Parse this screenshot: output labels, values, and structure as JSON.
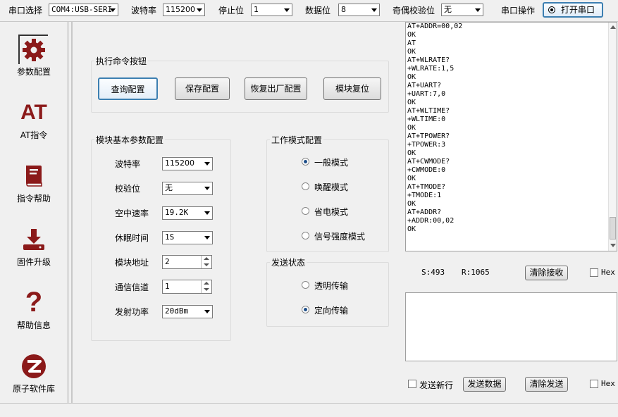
{
  "toolbar": {
    "port_label": "串口选择",
    "port_value": "COM4:USB-SERI",
    "baud_label": "波特率",
    "baud_value": "115200",
    "stop_label": "停止位",
    "stop_value": "1",
    "data_label": "数据位",
    "data_value": "8",
    "parity_label": "奇偶校验位",
    "parity_value": "无",
    "serial_op_label": "串口操作",
    "open_port_label": "打开串口"
  },
  "sidebar": {
    "items": [
      {
        "label": "参数配置",
        "icon": "gear-icon"
      },
      {
        "label": "AT指令",
        "icon": "at-icon"
      },
      {
        "label": "指令帮助",
        "icon": "book-icon"
      },
      {
        "label": "固件升级",
        "icon": "download-icon"
      },
      {
        "label": "帮助信息",
        "icon": "question-icon"
      },
      {
        "label": "原子软件库",
        "icon": "logo-icon"
      }
    ],
    "at_text": "AT",
    "help_text": "?"
  },
  "commands": {
    "title": "执行命令按钮",
    "query": "查询配置",
    "save": "保存配置",
    "restore": "恢复出厂配置",
    "reset": "模块复位"
  },
  "basic": {
    "title": "模块基本参数配置",
    "rows": [
      {
        "label": "波特率",
        "value": "115200"
      },
      {
        "label": "校验位",
        "value": "无"
      },
      {
        "label": "空中速率",
        "value": "19.2K"
      },
      {
        "label": "休眠时间",
        "value": "1S"
      },
      {
        "label": "模块地址",
        "value": "2"
      },
      {
        "label": "通信信道",
        "value": "1"
      },
      {
        "label": "发射功率",
        "value": "20dBm"
      }
    ]
  },
  "workmode": {
    "title": "工作模式配置",
    "options": [
      "一般模式",
      "唤醒模式",
      "省电模式",
      "信号强度模式"
    ],
    "selected": "一般模式"
  },
  "sendstate": {
    "title": "发送状态",
    "options": [
      "透明传输",
      "定向传输"
    ],
    "selected": "定向传输"
  },
  "receive": {
    "lines": "AT+ADDR=00,02\nOK\nAT\nOK\nAT+WLRATE?\n+WLRATE:1,5\nOK\nAT+UART?\n+UART:7,0\nOK\nAT+WLTIME?\n+WLTIME:0\nOK\nAT+TPOWER?\n+TPOWER:3\nOK\nAT+CWMODE?\n+CWMODE:0\nOK\nAT+TMODE?\n+TMODE:1\nOK\nAT+ADDR?\n+ADDR:00,02\nOK",
    "s_count": "S:493",
    "r_count": "R:1065",
    "clear_recv": "清除接收",
    "hex_label": "Hex"
  },
  "send": {
    "newline_label": "发送新行",
    "send_btn": "发送数据",
    "clear_btn": "清除发送",
    "hex_label": "Hex"
  },
  "colors": {
    "accent": "#8b1a1a",
    "selected_border": "#3c7fb1"
  }
}
